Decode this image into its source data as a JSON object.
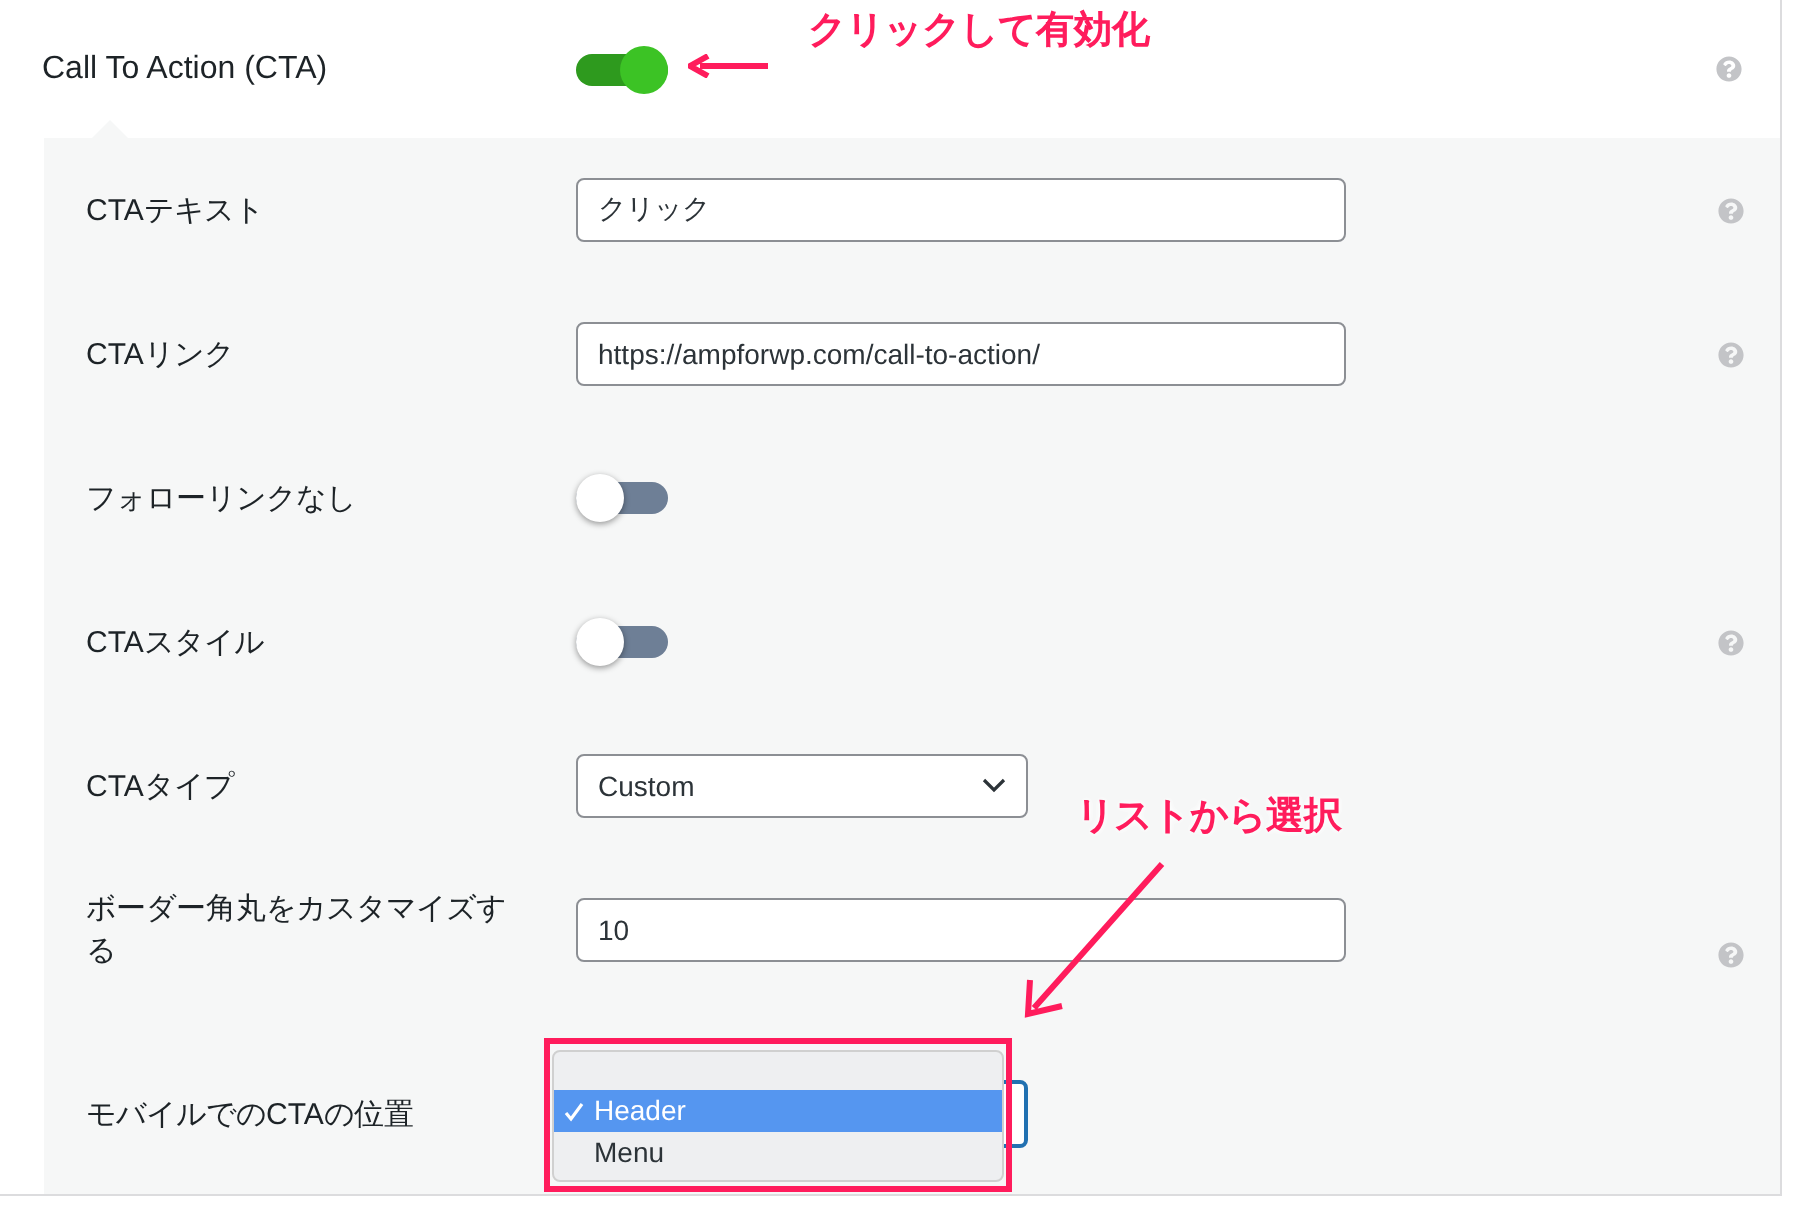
{
  "header": {
    "label": "Call To Action (CTA)",
    "on": true,
    "help": true
  },
  "rows": [
    {
      "kind": "text",
      "label": "CTAテキスト",
      "value": "クリック",
      "help": true
    },
    {
      "kind": "text",
      "label": "CTAリンク",
      "value": "https://ampforwp.com/call-to-action/",
      "help": true
    },
    {
      "kind": "toggle",
      "label": "フォローリンクなし",
      "on": false,
      "help": false
    },
    {
      "kind": "toggle",
      "label": "CTAスタイル",
      "on": false,
      "help": true
    },
    {
      "kind": "select",
      "label": "CTAタイプ",
      "value": "Custom",
      "help": false
    },
    {
      "kind": "text",
      "label": "ボーダー角丸をカスタマイズする",
      "value": "10",
      "help": true
    },
    {
      "kind": "dropdown",
      "label": "モバイルでのCTAの位置",
      "help": false,
      "options": [
        {
          "label": "Header",
          "selected": true
        },
        {
          "label": "Menu",
          "selected": false
        }
      ]
    }
  ],
  "annotations": [
    "クリックして有効化",
    "リストから選択"
  ]
}
